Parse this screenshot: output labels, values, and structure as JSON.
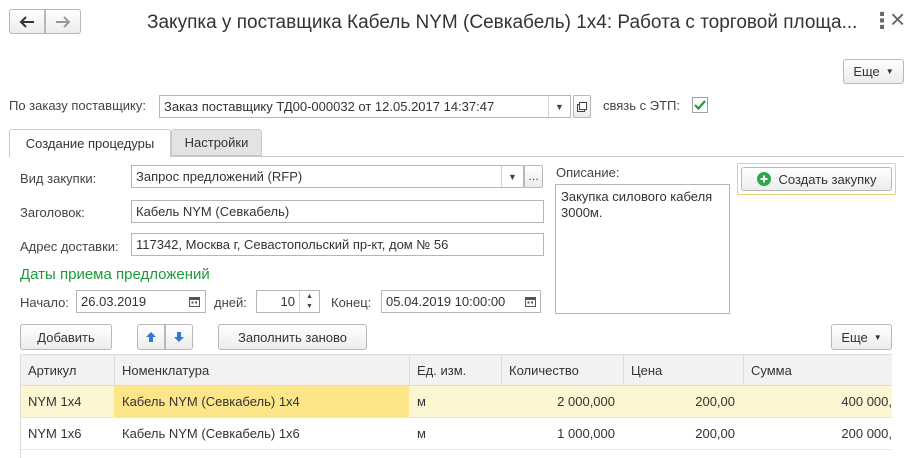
{
  "window": {
    "title": "Закупка у поставщика Кабель NYM (Севкабель) 1х4: Работа с торговой площа...",
    "more_label": "Еще",
    "menu_glyph": "⋮",
    "close_glyph": "×"
  },
  "order": {
    "label": "По заказу поставщику:",
    "value": "Заказ поставщику ТД00-000032 от 12.05.2017 14:37:47",
    "etp_label": "связь с ЭТП:",
    "etp_checked": true
  },
  "tabs": [
    {
      "label": "Создание процедуры",
      "active": true
    },
    {
      "label": "Настройки",
      "active": false
    }
  ],
  "form": {
    "kind_label": "Вид закупки:",
    "kind_value": "Запрос предложений (RFP)",
    "heading_label": "Заголовок:",
    "heading_value": "Кабель NYM (Севкабель)",
    "address_label": "Адрес доставки:",
    "address_value": "117342, Москва г, Севастопольский пр-кт, дом № 56",
    "description_label": "Описание:",
    "description_value": "Закупка силового кабеля 3000м.",
    "create_label": "Создать закупку"
  },
  "dates": {
    "section_title": "Даты приема предложений",
    "start_label": "Начало:",
    "start_value": "26.03.2019",
    "days_label": "дней:",
    "days_value": "10",
    "end_label": "Конец:",
    "end_value": "05.04.2019 10:00:00"
  },
  "toolbar": {
    "add_label": "Добавить",
    "refill_label": "Заполнить заново",
    "more_label": "Еще"
  },
  "table": {
    "columns": [
      "Артикул",
      "Номенклатура",
      "Ед. изм.",
      "Количество",
      "Цена",
      "Сумма"
    ],
    "rows": [
      {
        "article": "NYM 1x4",
        "name": "Кабель NYM (Севкабель) 1х4",
        "unit": "м",
        "qty": "2 000,000",
        "price": "200,00",
        "sum": "400 000,",
        "selected": true
      },
      {
        "article": "NYM 1x6",
        "name": "Кабель NYM (Севкабель) 1х6",
        "unit": "м",
        "qty": "1 000,000",
        "price": "200,00",
        "sum": "200 000,",
        "selected": false
      }
    ]
  },
  "colors": {
    "accent_green": "#1e9a3c",
    "selected_row": "#fdf6d3",
    "selected_cell": "#fde68a",
    "create_border": "#e6d277"
  }
}
